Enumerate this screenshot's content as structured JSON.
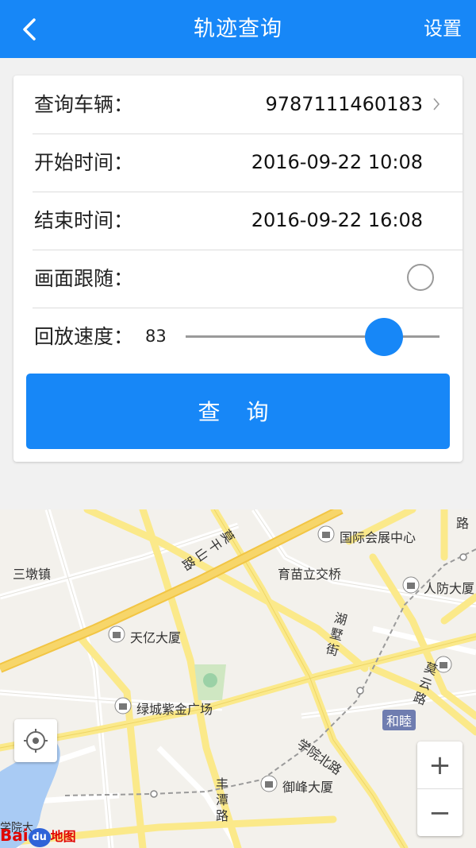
{
  "header": {
    "title": "轨迹查询",
    "settings_label": "设置",
    "back_icon": "chevron-left-icon"
  },
  "form": {
    "vehicle_label": "查询车辆：",
    "vehicle_value": "9787111460183",
    "start_label": "开始时间：",
    "start_value": "2016-09-22 10:08",
    "end_label": "结束时间：",
    "end_value": "2016-09-22 16:08",
    "follow_label": "画面跟随：",
    "speed_label": "回放速度：",
    "speed_value": "83",
    "query_button": "查 询"
  },
  "map": {
    "labels": [
      "三墩镇",
      "国际会展中心",
      "莫干山路",
      "育苗立交桥",
      "人防大厦",
      "天亿大厦",
      "湖墅街",
      "莫云路",
      "绿城紫金广场",
      "和睦",
      "学院北路",
      "御峰大厦",
      "丰潭路",
      "学院大",
      "路"
    ],
    "zoom_in": "+",
    "zoom_out": "−",
    "logo_bai": "Bai",
    "logo_du": "du",
    "logo_ditu": "地图"
  },
  "colors": {
    "accent": "#1787f7"
  }
}
